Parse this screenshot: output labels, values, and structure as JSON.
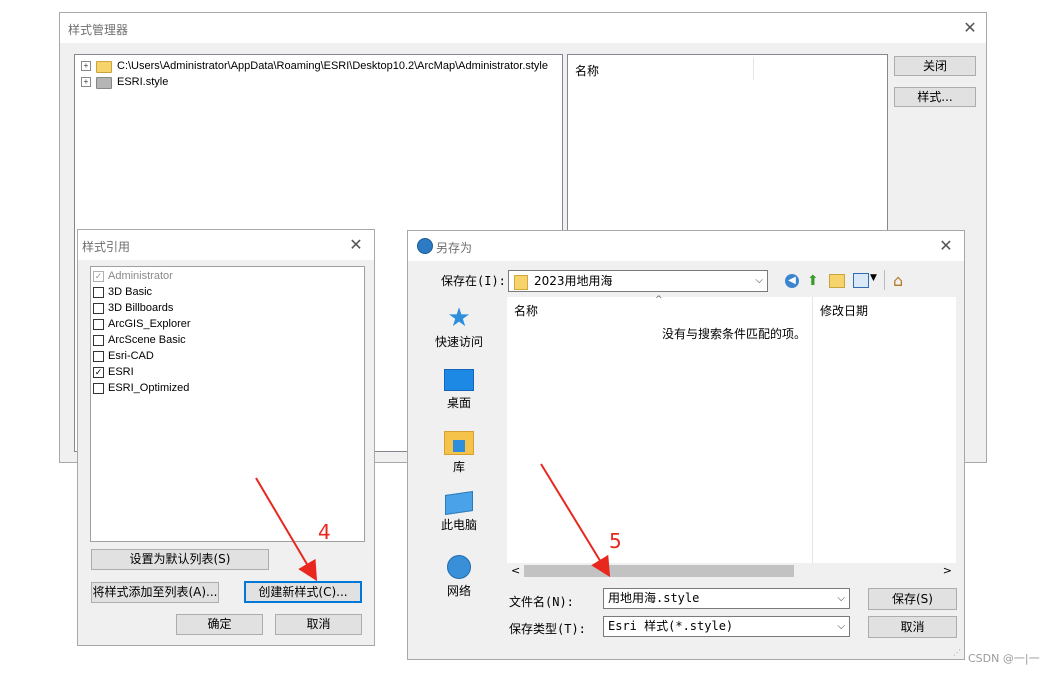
{
  "style_manager": {
    "title": "样式管理器",
    "tree": [
      {
        "label": "C:\\Users\\Administrator\\AppData\\Roaming\\ESRI\\Desktop10.2\\ArcMap\\Administrator.style"
      },
      {
        "label": "ESRI.style"
      }
    ],
    "list_header": "名称",
    "close_btn": "关闭",
    "styles_btn": "样式..."
  },
  "style_refs": {
    "title": "样式引用",
    "items": [
      {
        "label": "Administrator",
        "checked": true,
        "disabled": true
      },
      {
        "label": "3D Basic",
        "checked": false
      },
      {
        "label": "3D Billboards",
        "checked": false
      },
      {
        "label": "ArcGIS_Explorer",
        "checked": false
      },
      {
        "label": "ArcScene Basic",
        "checked": false
      },
      {
        "label": "Esri-CAD",
        "checked": false
      },
      {
        "label": "ESRI",
        "checked": true
      },
      {
        "label": "ESRI_Optimized",
        "checked": false
      }
    ],
    "set_default_btn": "设置为默认列表(S)",
    "add_to_list_btn": "将样式添加至列表(A)...",
    "create_new_btn": "创建新样式(C)...",
    "ok_btn": "确定",
    "cancel_btn": "取消"
  },
  "save_as": {
    "title": "另存为",
    "save_in_label": "保存在(I):",
    "save_in_value": "2023用地用海",
    "sidebar": [
      {
        "label": "快速访问",
        "icon": "star-icon"
      },
      {
        "label": "桌面",
        "icon": "desktop-icon"
      },
      {
        "label": "库",
        "icon": "library-icon"
      },
      {
        "label": "此电脑",
        "icon": "computer-icon"
      },
      {
        "label": "网络",
        "icon": "network-icon"
      }
    ],
    "col_name": "名称",
    "col_modified": "修改日期",
    "empty_message": "没有与搜索条件匹配的项。",
    "filename_label": "文件名(N):",
    "filename_value": "用地用海.style",
    "filetype_label": "保存类型(T):",
    "filetype_value": "Esri 样式(*.style)",
    "save_btn": "保存(S)",
    "cancel_btn": "取消"
  },
  "annotations": {
    "step4": "4",
    "step5": "5",
    "color": "#e8281e"
  },
  "watermark": "CSDN @一|一"
}
